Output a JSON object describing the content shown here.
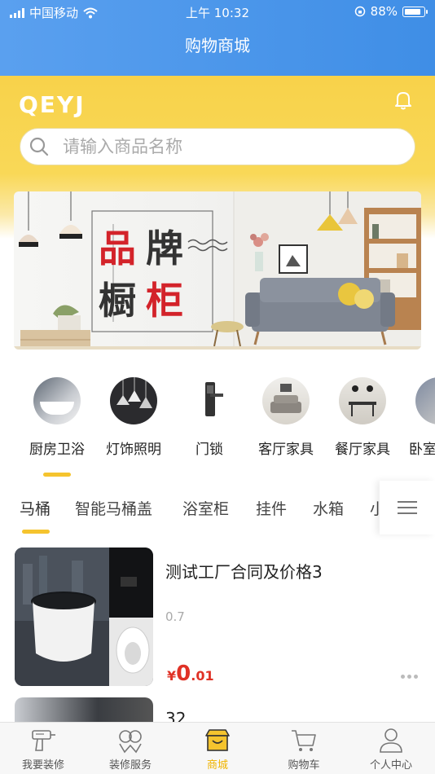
{
  "status_bar": {
    "carrier": "中国移动",
    "time": "上午 10:32",
    "battery": "88%"
  },
  "nav": {
    "title": "购物商城"
  },
  "header": {
    "logo": "QEYJ",
    "search_placeholder": "请输入商品名称"
  },
  "banner": {
    "line1": "品牌",
    "line2": "橱柜"
  },
  "categories": [
    {
      "label": "厨房卫浴"
    },
    {
      "label": "灯饰照明"
    },
    {
      "label": "门锁"
    },
    {
      "label": "客厅家具"
    },
    {
      "label": "餐厅家具"
    },
    {
      "label": "卧室"
    }
  ],
  "subtabs": [
    "马桶",
    "智能马桶盖",
    "浴室柜",
    "挂件",
    "水箱",
    "小"
  ],
  "products": [
    {
      "title": "测试工厂合同及价格3",
      "subtitle": "0.7",
      "price_symbol": "¥",
      "price_int": "0",
      "price_dec": ".01"
    },
    {
      "title": "32"
    }
  ],
  "tabbar": [
    {
      "label": "我要装修",
      "icon": "drill-icon"
    },
    {
      "label": "装修服务",
      "icon": "service-icon"
    },
    {
      "label": "商城",
      "icon": "store-icon",
      "active": true
    },
    {
      "label": "购物车",
      "icon": "cart-icon"
    },
    {
      "label": "个人中心",
      "icon": "user-icon"
    }
  ],
  "colors": {
    "nav_blue": "#4a96eb",
    "brand_yellow": "#f8d24a",
    "price_red": "#e03226",
    "active_tab": "#f0b400"
  }
}
